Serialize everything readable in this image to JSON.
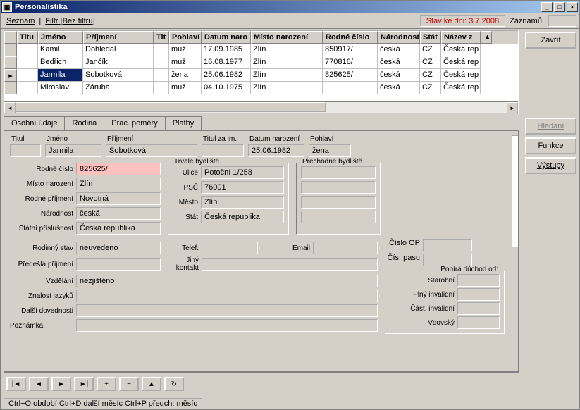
{
  "window": {
    "title": "Personalistika"
  },
  "toolbar": {
    "seznam": "Seznam",
    "filtr": "Filtr [Bez filtru]",
    "status": "Stav ke dni: 3.7.2008",
    "records_label": "Záznamů:"
  },
  "right_buttons": {
    "zavrit": "Zavřít",
    "hledani": "Hledání",
    "funkce": "Funkce",
    "vystupy": "Výstupy"
  },
  "grid": {
    "cols": {
      "titul": "Titu",
      "jmeno": "Jméno",
      "prijmeni": "Příjmení",
      "tit2": "Tit",
      "pohlavi": "Pohlaví",
      "datnar": "Datum naro",
      "mistonar": "Místo narození",
      "rc": "Rodné číslo",
      "narodnost": "Národnost",
      "stat": "Stát",
      "nazev": "Název z"
    },
    "rows": [
      {
        "titul": "",
        "jmeno": "Kamil",
        "prijmeni": "Dohledal",
        "tit2": "",
        "pohlavi": "muž",
        "datnar": "17.09.1985",
        "mistonar": "Zlín",
        "rc": "850917/",
        "narodnost": "česká",
        "stat": "CZ",
        "nazev": "Česká rep"
      },
      {
        "titul": "",
        "jmeno": "Bedřich",
        "prijmeni": "Jančík",
        "tit2": "",
        "pohlavi": "muž",
        "datnar": "16.08.1977",
        "mistonar": "Zlín",
        "rc": "770816/",
        "narodnost": "česká",
        "stat": "CZ",
        "nazev": "Česká rep"
      },
      {
        "titul": "",
        "jmeno": "Jarmila",
        "prijmeni": "Sobotková",
        "tit2": "",
        "pohlavi": "žena",
        "datnar": "25.06.1982",
        "mistonar": "Zlín",
        "rc": "825625/",
        "narodnost": "česká",
        "stat": "CZ",
        "nazev": "Česká rep"
      },
      {
        "titul": "",
        "jmeno": "Miroslav",
        "prijmeni": "Záruba",
        "tit2": "",
        "pohlavi": "muž",
        "datnar": "04.10.1975",
        "mistonar": "Zlín",
        "rc": "",
        "narodnost": "česká",
        "stat": "CZ",
        "nazev": "Česká rep"
      }
    ],
    "selected_row": 2
  },
  "tabs": {
    "osobni": "Osobní údaje",
    "rodina": "Rodina",
    "prac": "Prac. poměry",
    "platby": "Platby"
  },
  "detail": {
    "labels": {
      "titul": "Titul",
      "jmeno": "Jméno",
      "prijmeni": "Příjmení",
      "titul_za": "Titul za jm.",
      "datnar": "Datum narození",
      "pohlavi": "Pohlaví",
      "rc": "Rodné číslo",
      "mistonar": "Místo narození",
      "rodne_prijmeni": "Rodné příjmení",
      "narodnost": "Národnost",
      "statni_prisl": "Státní příslušnost",
      "trvale": "Trvalé bydliště",
      "prechodne": "Přechodné bydliště",
      "ulice": "Ulice",
      "psc": "PSČ",
      "mesto": "Město",
      "stat": "Stát",
      "rodinny_stav": "Rodinný stav",
      "telef": "Telef.",
      "email": "Email",
      "cislo_op": "Číslo OP",
      "predesla": "Předešlá příjmení",
      "jiny_kontakt": "Jiný kontakt",
      "cis_pasu": "Čís. pasu",
      "vzdelani": "Vzdělání",
      "znalost_jazyku": "Znalost jazyků",
      "dalsi_dov": "Další dovednosti",
      "poznamka": "Poznámka",
      "pobira": "Pobírá důchod od:",
      "starobni": "Starobní",
      "plny_inv": "Plný invalidní",
      "cast_inv": "Část. invalidní",
      "vdovsky": "Vdovský"
    },
    "values": {
      "titul": "",
      "jmeno": "Jarmila",
      "prijmeni": "Sobotková",
      "titul_za": "",
      "datnar": "25.06.1982",
      "pohlavi": "žena",
      "rc": "825625/",
      "mistonar": "Zlín",
      "rodne_prijmeni": "Novotná",
      "narodnost": "česká",
      "statni_prisl": "Česká republika",
      "ulice": "Potoční 1/258",
      "psc": "76001",
      "mesto": "Zlín",
      "stat_addr": "Česká republika",
      "rodinny_stav": "neuvedeno",
      "telef": "",
      "email": "",
      "cislo_op": "",
      "predesla": "",
      "jiny_kontakt": "",
      "cis_pasu": "",
      "vzdelani": "nezjištěno",
      "znalost_jazyku": "",
      "dalsi_dov": "",
      "poznamka": "",
      "starobni": "",
      "plny_inv": "",
      "cast_inv": "",
      "vdovsky": ""
    }
  },
  "nav": {
    "first": "|◄",
    "prev": "◄",
    "next": "►",
    "last": "►|",
    "add": "+",
    "del": "−",
    "edit": "▲",
    "refresh": "↻"
  },
  "statusbar": {
    "text": "Ctrl+O období  Ctrl+D další měsíc  Ctrl+P předch. měsíc"
  }
}
